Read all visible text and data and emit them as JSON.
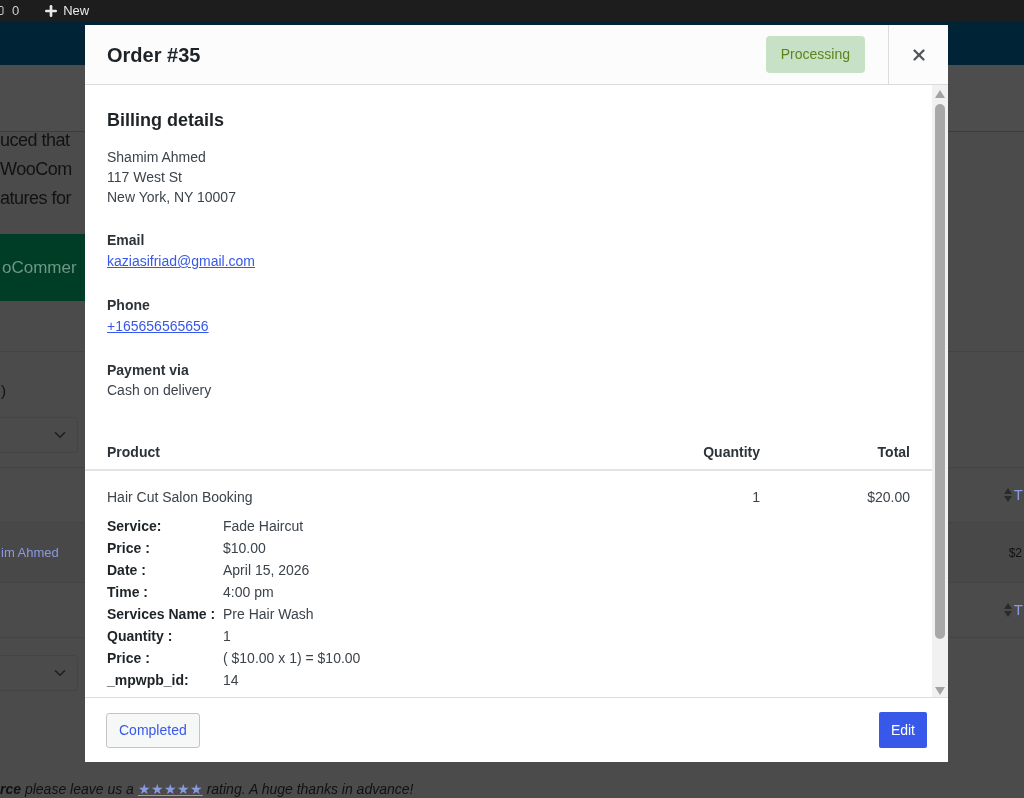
{
  "admin_bar": {
    "comments_count": "0",
    "new_label": "New"
  },
  "background": {
    "notice_lines": [
      "uced that",
      "WooCom",
      "atures for"
    ],
    "button": "oCommer",
    "count_text": ")",
    "customer_link": "im Ahmed",
    "amount": "$2",
    "sort_labels": [
      "T",
      "T"
    ],
    "footer": {
      "before": "**rce** please leave us a",
      "link": "★★★★★",
      "after": "rating. A huge thanks in advance!"
    }
  },
  "modal": {
    "title": "Order #35",
    "status": "Processing",
    "billing": {
      "heading": "Billing details",
      "address": [
        "Shamim Ahmed",
        "117 West St",
        "New York, NY 10007"
      ],
      "fields": [
        {
          "label": "Email",
          "value": "kaziasifriad@gmail.com",
          "kind": "link"
        },
        {
          "label": "Phone",
          "value": "+165656565656",
          "kind": "link"
        },
        {
          "label": "Payment via",
          "value": "Cash on delivery",
          "kind": "text"
        }
      ]
    },
    "table": {
      "columns": [
        "Product",
        "Quantity",
        "Total"
      ],
      "rows": [
        {
          "product": "Hair Cut Salon Booking",
          "quantity": "1",
          "total": "$20.00",
          "meta": [
            {
              "label": "Service:",
              "value": "Fade Haircut"
            },
            {
              "label": "Price :",
              "value": "$10.00"
            },
            {
              "label": "Date :",
              "value": "April 15, 2026"
            },
            {
              "label": "Time :",
              "value": "4:00 pm"
            },
            {
              "label": "Services Name :",
              "value": "Pre Hair Wash"
            },
            {
              "label": "Quantity :",
              "value": "1"
            },
            {
              "label": "Price :",
              "value": "( $10.00 x 1) = $10.00"
            },
            {
              "label": "_mpwpb_id:",
              "value": "14"
            }
          ]
        }
      ]
    },
    "buttons": [
      {
        "label": "Completed",
        "kind": "secondary"
      },
      {
        "label": "Edit",
        "kind": "primary"
      }
    ]
  }
}
